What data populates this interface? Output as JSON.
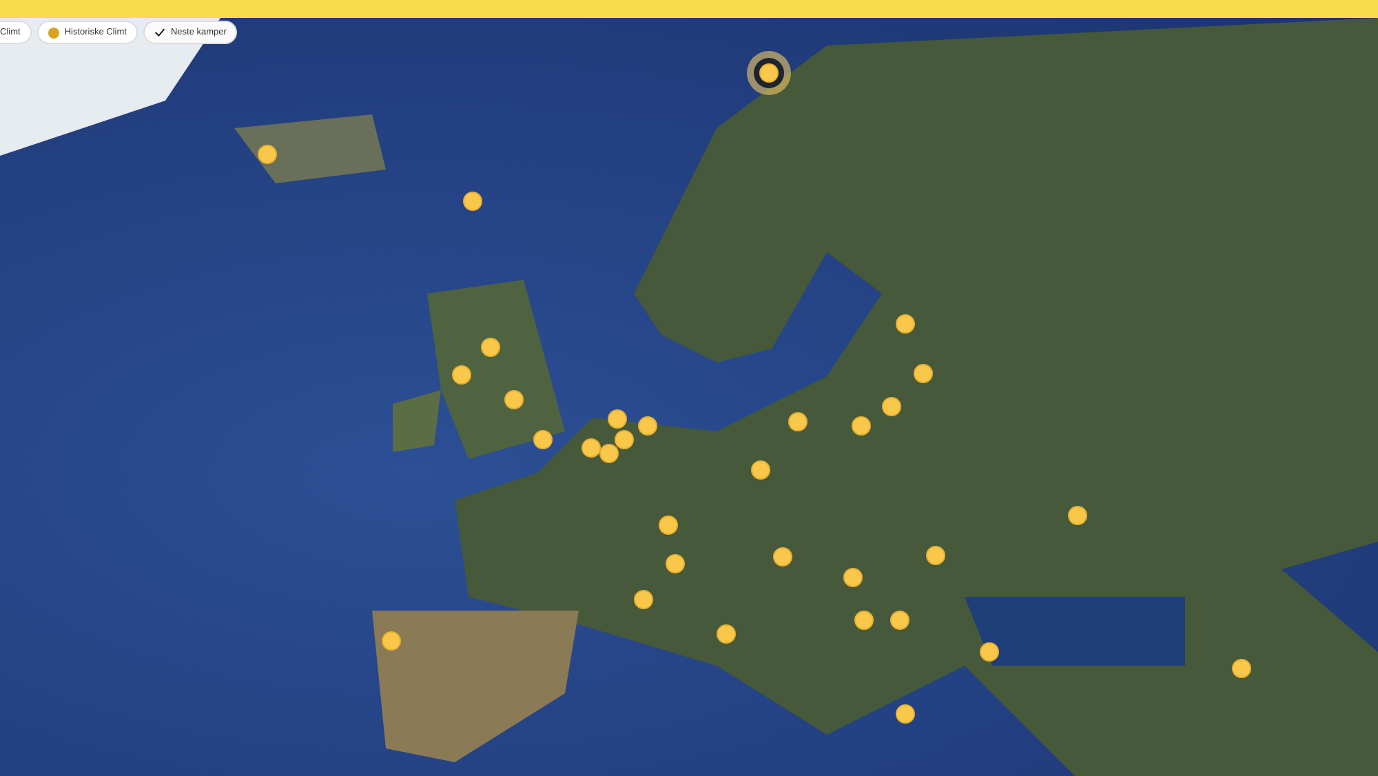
{
  "filters": [
    {
      "label": "Climt",
      "kind": "plain",
      "selected": false
    },
    {
      "label": "Historiske Climt",
      "kind": "dot",
      "color": "#d9a21f",
      "selected": false
    },
    {
      "label": "Neste kamper",
      "kind": "plain",
      "selected": true
    }
  ],
  "markers": [
    {
      "highlighted": true
    },
    {
      "highlighted": false
    },
    {
      "highlighted": false
    },
    {
      "highlighted": false
    },
    {
      "highlighted": false
    },
    {
      "highlighted": false
    },
    {
      "highlighted": false
    },
    {
      "highlighted": false
    },
    {
      "highlighted": false
    },
    {
      "highlighted": false
    },
    {
      "highlighted": false
    },
    {
      "highlighted": false
    },
    {
      "highlighted": false
    },
    {
      "highlighted": false
    },
    {
      "highlighted": false
    },
    {
      "highlighted": false
    },
    {
      "highlighted": false
    },
    {
      "highlighted": false
    },
    {
      "highlighted": false
    },
    {
      "highlighted": false
    },
    {
      "highlighted": false
    },
    {
      "highlighted": false
    },
    {
      "highlighted": false
    },
    {
      "highlighted": false
    },
    {
      "highlighted": false
    },
    {
      "highlighted": false
    },
    {
      "highlighted": false
    },
    {
      "highlighted": false
    },
    {
      "highlighted": false
    },
    {
      "highlighted": false
    },
    {
      "highlighted": false
    },
    {
      "highlighted": false
    }
  ]
}
